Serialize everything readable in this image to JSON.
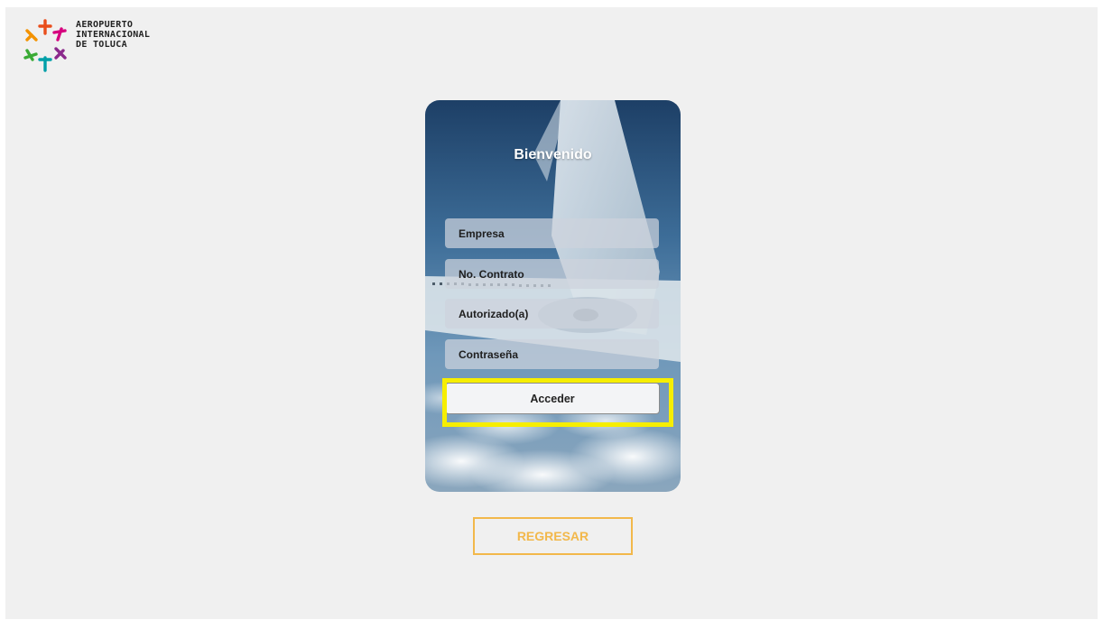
{
  "logo": {
    "lines": [
      "AEROPUERTO",
      "INTERNACIONAL",
      "DE TOLUCA"
    ],
    "colors": [
      "#e94e1b",
      "#d6007e",
      "#8b2a8c",
      "#009fa8",
      "#3aaa35",
      "#f39200"
    ]
  },
  "card": {
    "title": "Bienvenido",
    "fields": {
      "empresa": "Empresa",
      "contrato": "No. Contrato",
      "autorizado": "Autorizado(a)",
      "contrasena": "Contraseña"
    },
    "submit_label": "Acceder"
  },
  "back_label": "REGRESAR",
  "colors": {
    "background": "#f0f0f0",
    "accent": "#f2b84b",
    "highlight": "#f6ee00"
  }
}
